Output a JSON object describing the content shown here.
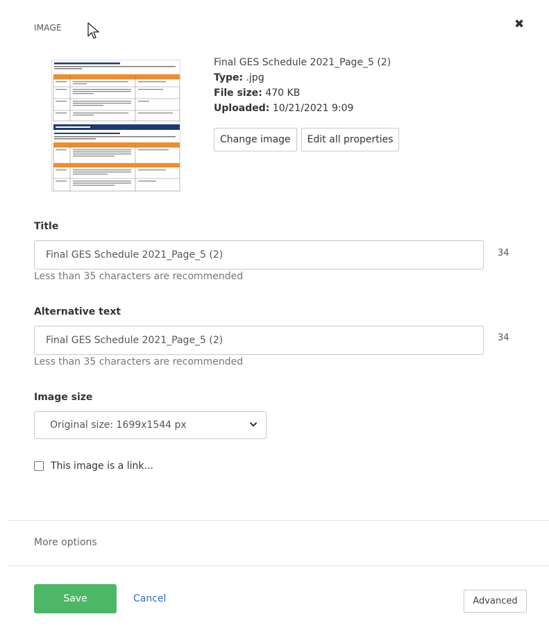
{
  "dialog": {
    "header_label": "IMAGE",
    "icons": {
      "close": "close-icon",
      "cursor": "cursor-arrow-icon",
      "chevron": "chevron-down-icon",
      "checkbox": "checkbox-icon"
    }
  },
  "image_info": {
    "file_name": "Final GES Schedule 2021_Page_5 (2)",
    "type_label": "Type:",
    "type_value": ".jpg",
    "size_label": "File size:",
    "size_value": "470 KB",
    "uploaded_label": "Uploaded:",
    "uploaded_value": "10/21/2021 9:09",
    "change_image_label": "Change image",
    "edit_all_label": "Edit all properties"
  },
  "title_field": {
    "label": "Title",
    "value": "Final GES Schedule 2021_Page_5 (2)",
    "count": "34",
    "hint": "Less than 35 characters are recommended"
  },
  "alt_field": {
    "label": "Alternative text",
    "value": "Final GES Schedule 2021_Page_5 (2)",
    "count": "34",
    "hint": "Less than 35 characters are recommended"
  },
  "size_field": {
    "label": "Image size",
    "selected": "Original size: 1699x1544 px"
  },
  "link_checkbox": {
    "label": "This image is a link...",
    "checked": false
  },
  "more_options_label": "More options",
  "footer": {
    "save_label": "Save",
    "cancel_label": "Cancel",
    "advanced_label": "Advanced"
  },
  "colors": {
    "save": "#4cb766",
    "cancel_link": "#2a6ebb",
    "thumb_orange": "#f28c28",
    "thumb_navy": "#1f3b6f"
  }
}
